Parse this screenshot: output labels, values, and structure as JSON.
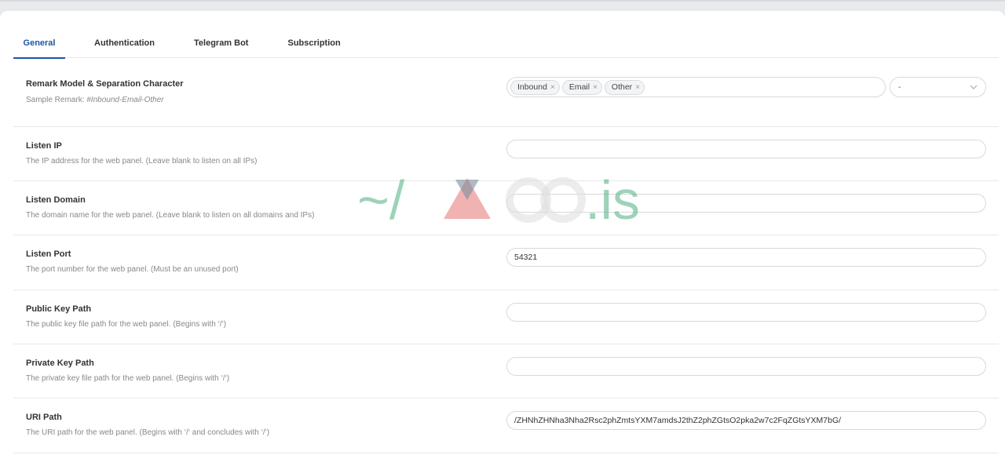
{
  "tabs": [
    {
      "label": "General"
    },
    {
      "label": "Authentication"
    },
    {
      "label": "Telegram Bot"
    },
    {
      "label": "Subscription"
    }
  ],
  "remark": {
    "label": "Remark Model & Separation Character",
    "desc_prefix": "Sample Remark: ",
    "desc_example": "#Inbound-Email-Other",
    "tags": [
      "Inbound",
      "Email",
      "Other"
    ],
    "separator": "-"
  },
  "listen_ip": {
    "label": "Listen IP",
    "desc": "The IP address for the web panel. (Leave blank to listen on all IPs)",
    "value": ""
  },
  "listen_domain": {
    "label": "Listen Domain",
    "desc": "The domain name for the web panel. (Leave blank to listen on all domains and IPs)",
    "value": ""
  },
  "listen_port": {
    "label": "Listen Port",
    "desc": "The port number for the web panel. (Must be an unused port)",
    "value": "54321"
  },
  "public_key": {
    "label": "Public Key Path",
    "desc": "The public key file path for the web panel. (Begins with ‘/‘)",
    "value": ""
  },
  "private_key": {
    "label": "Private Key Path",
    "desc": "The private key file path for the web panel. (Begins with ‘/‘)",
    "value": ""
  },
  "uri_path": {
    "label": "URI Path",
    "desc": "The URI path for the web panel. (Begins with ‘/‘ and concludes with ‘/‘)",
    "value": "/ZHNhZHNha3Nha2Rsc2phZmtsYXM7amdsJ2thZ2phZGtsO2pka2w7c2FqZGtsYXM7bG/"
  },
  "watermark": {
    "text_left": "~/",
    "text_right": ".is",
    "colors": {
      "green": "#4caf7d",
      "red": "#e57373",
      "slate": "#7a8ea0"
    }
  }
}
